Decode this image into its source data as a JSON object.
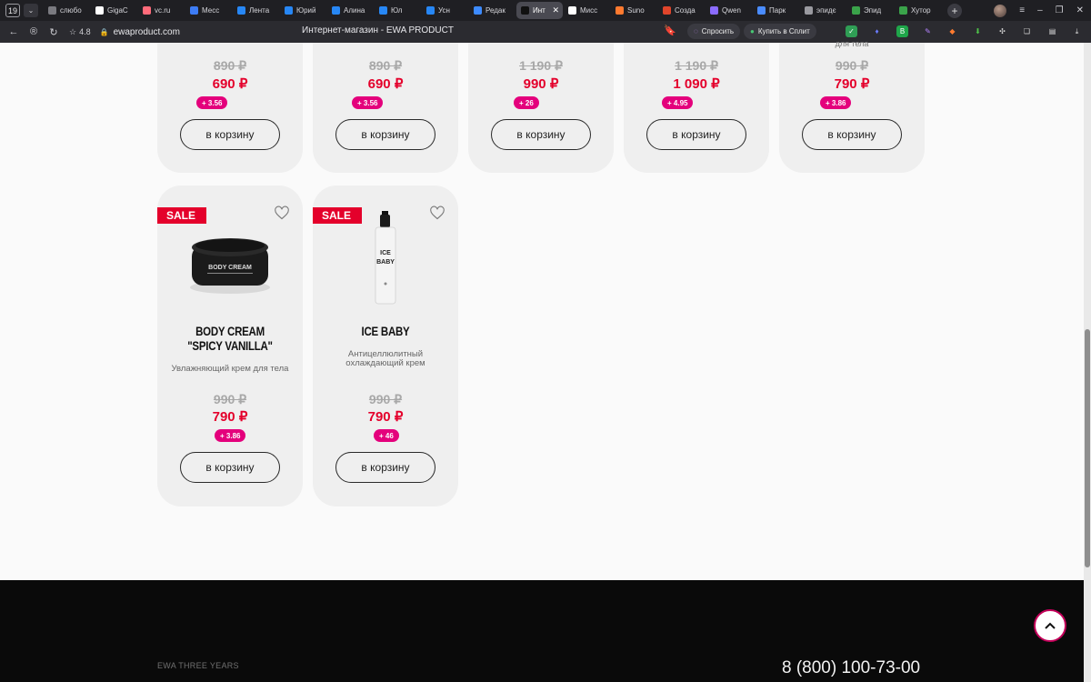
{
  "browser": {
    "tab_count": "19",
    "tabs": [
      {
        "title": "слюбо",
        "color": "#7a7a80",
        "active": false
      },
      {
        "title": "GigaC",
        "color": "#ffffff",
        "active": false
      },
      {
        "title": "vc.ru",
        "color": "#ff6b7a",
        "active": false
      },
      {
        "title": "Месс",
        "color": "#3d7cf5",
        "active": false
      },
      {
        "title": "Лента",
        "color": "#2787f5",
        "active": false
      },
      {
        "title": "Юрий",
        "color": "#2787f5",
        "active": false
      },
      {
        "title": "Алина",
        "color": "#2787f5",
        "active": false
      },
      {
        "title": "Юл",
        "color": "#2787f5",
        "active": false
      },
      {
        "title": "Усн",
        "color": "#2787f5",
        "active": false
      },
      {
        "title": "Редак",
        "color": "#3d8bff",
        "active": false
      },
      {
        "title": "Инт",
        "color": "#111111",
        "active": true
      },
      {
        "title": "Мисс",
        "color": "#ffffff",
        "active": false
      },
      {
        "title": "Suno",
        "color": "#ff7a2f",
        "active": false
      },
      {
        "title": "Созда",
        "color": "#e0452b",
        "active": false
      },
      {
        "title": "Qwen",
        "color": "#8b6cff",
        "active": false
      },
      {
        "title": "Парк",
        "color": "#4a8cff",
        "active": false
      },
      {
        "title": "эпидє",
        "color": "#9a9aa0",
        "active": false
      },
      {
        "title": "Эпид",
        "color": "#3aa34a",
        "active": false
      },
      {
        "title": "Хутор",
        "color": "#3aa34a",
        "active": false
      }
    ],
    "rating": "4.8",
    "url": "ewaproduct.com",
    "page_title": "Интернет-магазин - EWA PRODUCT",
    "ask_label": "Спросить",
    "split_label": "Купить в Сплит"
  },
  "top_row": [
    {
      "desc": "",
      "old_price": "890 ₽",
      "price": "690 ₽",
      "bonus": "+ 3.56",
      "cart": "в корзину"
    },
    {
      "desc": "",
      "old_price": "890 ₽",
      "price": "690 ₽",
      "bonus": "+ 3.56",
      "cart": "в корзину"
    },
    {
      "desc": "",
      "old_price": "1 190 ₽",
      "price": "990 ₽",
      "bonus": "+ 26",
      "cart": "в корзину"
    },
    {
      "desc": "",
      "old_price": "1 190 ₽",
      "price": "1 090 ₽",
      "bonus": "+ 4.95",
      "cart": "в корзину"
    },
    {
      "desc": "для тела",
      "old_price": "990 ₽",
      "price": "790 ₽",
      "bonus": "+ 3.86",
      "cart": "в корзину"
    }
  ],
  "products": [
    {
      "badge": "SALE",
      "name": "BODY CREAM \"SPICY VANILLA\"",
      "desc": "Увлажняющий крем для тела",
      "old_price": "990 ₽",
      "price": "790 ₽",
      "bonus": "+ 3.86",
      "cart": "в корзину",
      "jar_label": "BODY CREAM"
    },
    {
      "badge": "SALE",
      "name": "ICE BABY",
      "desc": "Антицеллюлитный охлаждающий крем",
      "old_price": "990 ₽",
      "price": "790 ₽",
      "bonus": "+ 46",
      "cart": "в корзину",
      "bottle_label": "ICE BABY"
    }
  ],
  "footer": {
    "brand": "EWA THREE YEARS",
    "phone": "8 (800) 100-73-00"
  },
  "colors": {
    "accent_red": "#e4002b",
    "bonus_pink": "#e4007c",
    "card_bg": "#efefef"
  }
}
